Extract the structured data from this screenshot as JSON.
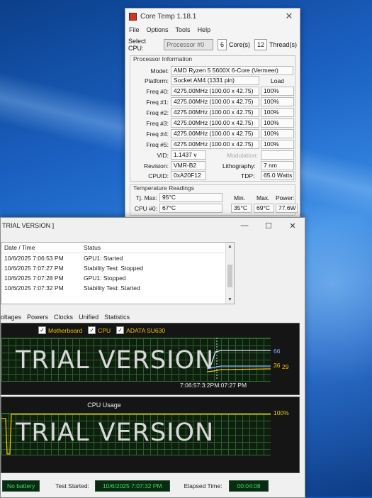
{
  "coretemp": {
    "title": "Core Temp 1.18.1",
    "menu": [
      "File",
      "Options",
      "Tools",
      "Help"
    ],
    "select_cpu_label": "Select CPU:",
    "select_cpu_value": "Processor #0",
    "cores_value": "6",
    "cores_label": "Core(s)",
    "threads_value": "12",
    "threads_label": "Thread(s)",
    "processor_info_label": "Processor Information",
    "model_label": "Model:",
    "model_value": "AMD Ryzen 5 5600X 6-Core (Vermeer)",
    "platform_label": "Platform:",
    "platform_value": "Socket AM4 (1331 pin)",
    "load_label": "Load",
    "freqs": [
      {
        "label": "Freq #0:",
        "value": "4275.00MHz (100.00 x 42.75)",
        "load": "100%"
      },
      {
        "label": "Freq #1:",
        "value": "4275.00MHz (100.00 x 42.75)",
        "load": "100%"
      },
      {
        "label": "Freq #2:",
        "value": "4275.00MHz (100.00 x 42.75)",
        "load": "100%"
      },
      {
        "label": "Freq #3:",
        "value": "4275.00MHz (100.00 x 42.75)",
        "load": "100%"
      },
      {
        "label": "Freq #4:",
        "value": "4275.00MHz (100.00 x 42.75)",
        "load": "100%"
      },
      {
        "label": "Freq #5:",
        "value": "4275.00MHz (100.00 x 42.75)",
        "load": "100%"
      }
    ],
    "vid_label": "VID:",
    "vid_value": "1.1437 v",
    "modulation_label": "Modulation:",
    "revision_label": "Revision:",
    "revision_value": "VMR-B2",
    "lithography_label": "Lithography:",
    "lithography_value": "7 nm",
    "cpuid_label": "CPUID:",
    "cpuid_value": "0xA20F12",
    "tdp_label": "TDP:",
    "tdp_value": "65.0 Watts",
    "temp_label": "Temperature Readings",
    "tjmax_label": "Tj. Max:",
    "tjmax_value": "95°C",
    "min_label": "Min.",
    "max_label": "Max.",
    "power_label": "Power:",
    "cpu0_label": "CPU #0:",
    "cpu0_temp": "67°C",
    "cpu0_min": "35°C",
    "cpu0_max": "69°C",
    "cpu0_power": "77.6W"
  },
  "occt": {
    "title": "TRIAL VERSION ]",
    "controls": [
      "—",
      "☐",
      "✕"
    ],
    "log_headers": [
      "Date / Time",
      "Status"
    ],
    "log_rows": [
      {
        "time": "10/6/2025 7:06:53 PM",
        "status": "GPU1: Started"
      },
      {
        "time": "10/6/2025 7:07:27 PM",
        "status": "Stability Test: Stopped"
      },
      {
        "time": "10/6/2025 7:07:28 PM",
        "status": "GPU1: Stopped"
      },
      {
        "time": "10/6/2025 7:07:32 PM",
        "status": "Stability Test: Started"
      }
    ],
    "tabs": [
      "oltages",
      "Powers",
      "Clocks",
      "Unified",
      "Statistics"
    ],
    "temp_legend": [
      "Motherboard",
      "CPU",
      "ADATA SU630"
    ],
    "watermark": "TRIAL VERSION",
    "temp_value_top": "66",
    "temp_value_mid": "36",
    "temp_value_low": "29",
    "graph_time": "7:06:57:3:2PM:07:27 PM",
    "cpu_usage_label": "CPU Usage",
    "cpu_usage_value": "100%",
    "battery": "No battery",
    "test_started_label": "Test Started:",
    "test_started_value": "10/6/2025 7:07:32 PM",
    "elapsed_label": "Elapsed Time:",
    "elapsed_value": "00:04:08"
  }
}
